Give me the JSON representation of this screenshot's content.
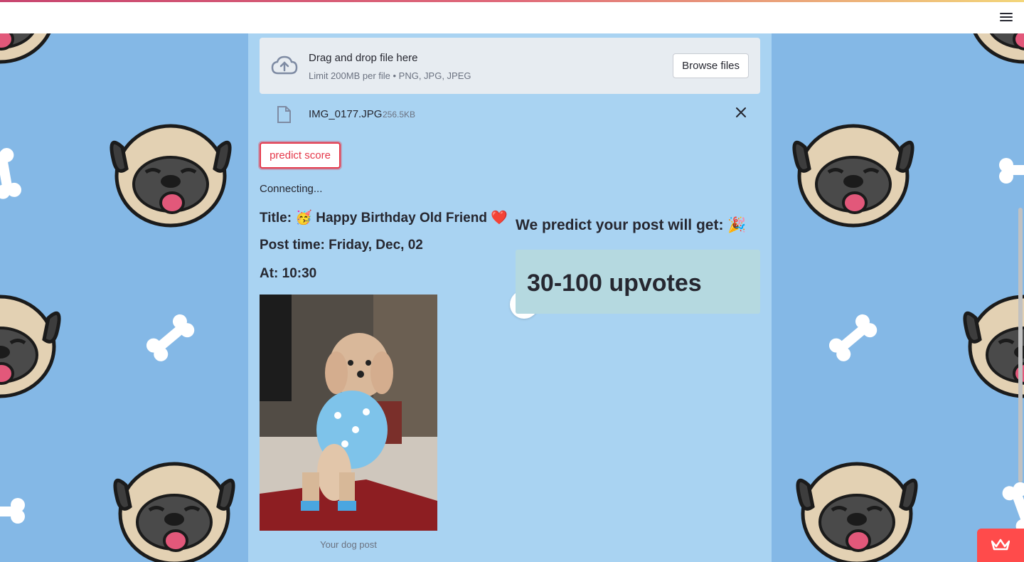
{
  "header": {
    "menu_icon": "hamburger-icon"
  },
  "background": {
    "pattern": "pug-and-bone",
    "color": "#84b8e6"
  },
  "uploader": {
    "icon": "cloud-upload-icon",
    "title": "Drag and drop file here",
    "limit": "Limit 200MB per file • PNG, JPG, JPEG",
    "browse_label": "Browse files"
  },
  "file": {
    "icon": "file-icon",
    "name": "IMG_0177.JPG",
    "size": "256.5KB",
    "remove_icon": "close-icon"
  },
  "actions": {
    "predict_label": "predict score",
    "accent_color": "#e5394b"
  },
  "status": {
    "text": "Connecting..."
  },
  "post": {
    "title_line": "Title: 🥳 Happy Birthday Old Friend ❤️",
    "time_line": "Post time: Friday, Dec, 02",
    "at_line": "At: 10:30",
    "image_caption": "Your dog post"
  },
  "prediction": {
    "heading": "We predict your post will get: 🎉",
    "result": "30-100 upvotes"
  },
  "corner_badge": {
    "icon": "crown-icon",
    "color": "#ff4b4b"
  }
}
